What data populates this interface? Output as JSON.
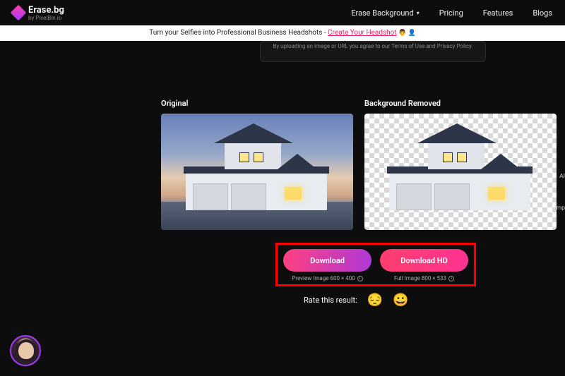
{
  "brand": {
    "name": "Erase.bg",
    "byline": "by PixelBin.io"
  },
  "nav": {
    "items": [
      {
        "label": "Erase Background",
        "hasDropdown": true
      },
      {
        "label": "Pricing",
        "hasDropdown": false
      },
      {
        "label": "Features",
        "hasDropdown": false
      },
      {
        "label": "Blogs",
        "hasDropdown": false
      }
    ]
  },
  "banner": {
    "lead": "Turn your Selfies into Professional Business Headshots - ",
    "cta": "Create Your Headshot",
    "tail_icons": "👨 👤"
  },
  "upload_note": "By uploading an image or URL you agree to our Terms of Use and Privacy Policy.",
  "panels": {
    "original_label": "Original",
    "removed_label": "Background Removed"
  },
  "downloads": {
    "preview": {
      "button": "Download",
      "caption": "Preview Image 600 × 400"
    },
    "hd": {
      "button": "Download HD",
      "caption": "Full Image 800 × 533"
    }
  },
  "rate": {
    "label": "Rate this result:",
    "bored": "😔",
    "happy": "😀"
  },
  "side": {
    "ai": "AI",
    "improve": "Imp"
  }
}
